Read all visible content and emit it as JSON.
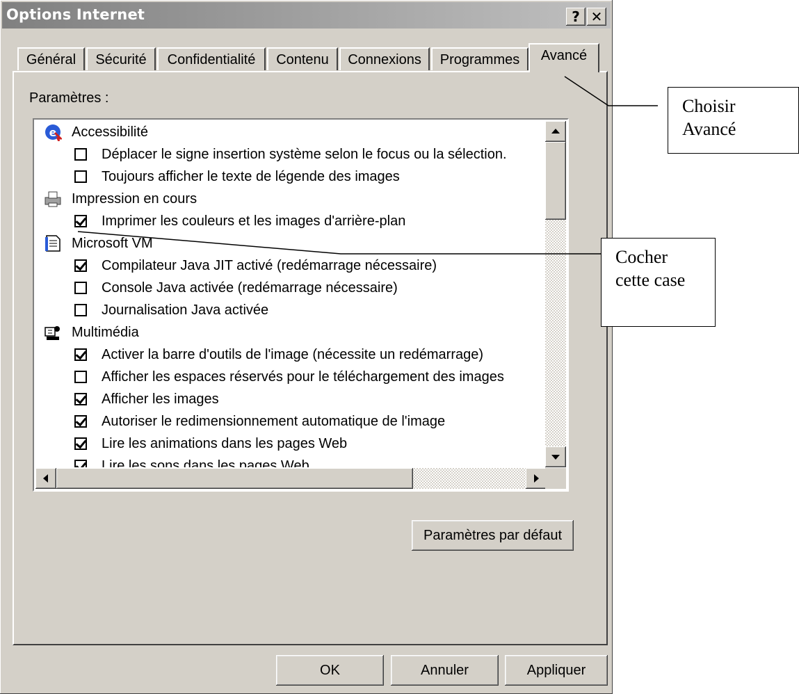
{
  "window": {
    "title": "Options Internet",
    "help_button": "?",
    "close_button": "✕"
  },
  "tabs": [
    {
      "label": "Général"
    },
    {
      "label": "Sécurité"
    },
    {
      "label": "Confidentialité"
    },
    {
      "label": "Contenu"
    },
    {
      "label": "Connexions"
    },
    {
      "label": "Programmes"
    },
    {
      "label": "Avancé"
    }
  ],
  "active_tab": "Avancé",
  "settings": {
    "label": "Paramètres :",
    "categories": [
      {
        "label": "Accessibilité",
        "icon": "accessibility-icon",
        "items": [
          {
            "label": "Déplacer le signe insertion système selon le focus ou la sélection.",
            "checked": false
          },
          {
            "label": "Toujours afficher le texte de légende des images",
            "checked": false
          }
        ]
      },
      {
        "label": "Impression en cours",
        "icon": "printer-icon",
        "items": [
          {
            "label": "Imprimer les couleurs et les images d'arrière-plan",
            "checked": true
          }
        ]
      },
      {
        "label": "Microsoft VM",
        "icon": "document-icon",
        "items": [
          {
            "label": "Compilateur Java JIT activé (redémarrage nécessaire)",
            "checked": true
          },
          {
            "label": "Console Java activée (redémarrage nécessaire)",
            "checked": false
          },
          {
            "label": "Journalisation Java activée",
            "checked": false
          }
        ]
      },
      {
        "label": "Multimédia",
        "icon": "multimedia-icon",
        "items": [
          {
            "label": "Activer la barre d'outils de l'image (nécessite un redémarrage)",
            "checked": true
          },
          {
            "label": "Afficher les espaces réservés pour le téléchargement des images",
            "checked": false
          },
          {
            "label": "Afficher les images",
            "checked": true
          },
          {
            "label": "Autoriser le redimensionnement automatique de l'image",
            "checked": true
          },
          {
            "label": "Lire les animations dans les pages Web",
            "checked": true
          },
          {
            "label": "Lire les sons dans les pages Web",
            "checked": true
          }
        ]
      }
    ]
  },
  "buttons": {
    "defaults": "Paramètres par défaut",
    "ok": "OK",
    "cancel": "Annuler",
    "apply": "Appliquer"
  },
  "callouts": {
    "tab_hint": {
      "line1": "Choisir",
      "line2": "Avancé"
    },
    "checkbox_hint": {
      "line1": "Cocher",
      "line2": "cette case"
    }
  }
}
